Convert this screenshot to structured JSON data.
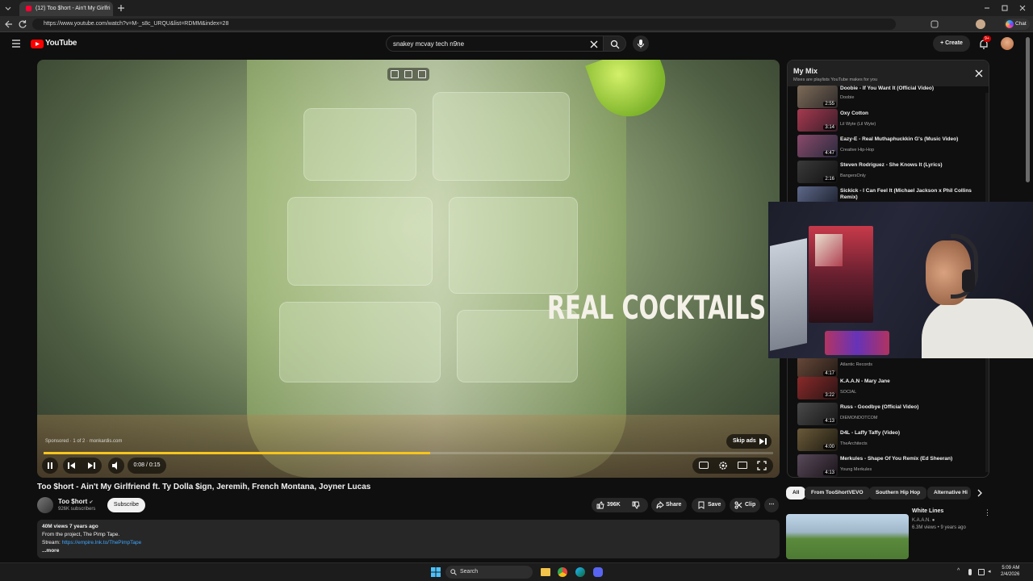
{
  "browser": {
    "tab_title": "(12) Too $hort - Ain't My Girlfri",
    "url": "https://www.youtube.com/watch?v=M-_s8c_URQU&list=RDMM&index=28",
    "chat_label": "Chat"
  },
  "masthead": {
    "logo_text": "YouTube",
    "search_value": "snakey mcvay tech n9ne",
    "create_label": "Create",
    "notification_badge": "9+"
  },
  "player": {
    "ad_text": "REAL COCKTAILS.",
    "sponsored_text": "Sponsored · 1 of 2 · monkardis.com",
    "skip_label": "Skip ads",
    "time": "0:08 / 0:15",
    "progress_fraction": 0.53
  },
  "video": {
    "title": "Too $hort - Ain't My Girlfriend ft. Ty Dolla $ign, Jeremih, French Montana, Joyner Lucas",
    "channel": "Too $hort",
    "subscribers": "926K subscribers",
    "subscribe_label": "Subscribe",
    "likes": "396K",
    "share_label": "Share",
    "save_label": "Save",
    "clip_label": "Clip",
    "views_age": "40M views  7 years ago",
    "desc_line1": "From the project, The Pimp Tape.",
    "desc_stream_label": "Stream:",
    "desc_stream_link": "https://empire.lnk.to/ThePimpTape",
    "desc_more": "...more"
  },
  "mix": {
    "title": "My Mix",
    "subtitle": "Mixes are playlists YouTube makes for you",
    "items": [
      {
        "title": "Doobie - If You Want It (Official Video)",
        "artist": "Doobie",
        "duration": "2:55"
      },
      {
        "title": "Oxy Cotton",
        "artist": "Lil Wyte (Lil Wyte)",
        "duration": "3:14"
      },
      {
        "title": "Eazy-E - Real Muthaphuckkin G's (Music Video)",
        "artist": "Creative Hip-Hop",
        "duration": "4:47"
      },
      {
        "title": "Steven Rodriguez - She Knows It (Lyrics)",
        "artist": "BangersOnly",
        "duration": "2:16"
      },
      {
        "title": "Sickick - I Can Feel It (Michael Jackson x Phil Collins Remix)",
        "artist": "",
        "duration": ""
      },
      {
        "title": "",
        "artist": "Atlantic Records",
        "duration": "4:17"
      },
      {
        "title": "K.A.A.N - Mary Jane",
        "artist": "SOCIAL",
        "duration": "3:22"
      },
      {
        "title": "Russ - Goodbye (Official Video)",
        "artist": "DIEMONDOTCOM",
        "duration": "4:13"
      },
      {
        "title": "D4L - Laffy Taffy (Video)",
        "artist": "TheArchitects",
        "duration": "4:00"
      },
      {
        "title": "Merkules - Shape Of You Remix (Ed Sheeran)",
        "artist": "Young Merkules",
        "duration": "4:13"
      }
    ]
  },
  "chips": [
    "All",
    "From TooShortVEVO",
    "Southern Hip Hop",
    "Alternative Hi"
  ],
  "recommended": {
    "title": "White Lines",
    "channel": "K.A.A.N.",
    "meta": "6.3M views • 9 years ago"
  },
  "taskbar": {
    "search_label": "Search",
    "time": "5:09 AM",
    "date": "2/4/2026"
  }
}
